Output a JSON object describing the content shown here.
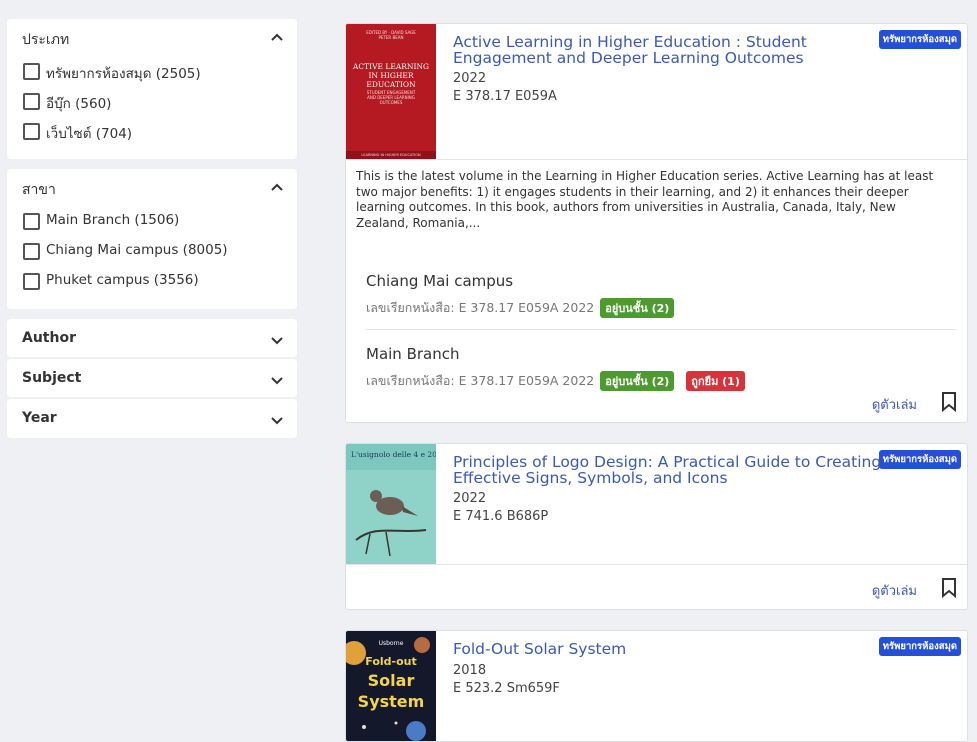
{
  "filters": {
    "type": {
      "title": "ประเภท",
      "options": [
        "ทรัพยากรห้องสมุด (2505)",
        "อีบุ๊ก (560)",
        "เว็บไซต์ (704)"
      ]
    },
    "branch": {
      "title": "สาขา",
      "options": [
        "Main Branch (1506)",
        "Chiang Mai campus (8005)",
        "Phuket campus (3556)"
      ]
    },
    "author": {
      "title": "Author"
    },
    "subject": {
      "title": "Subject"
    },
    "year": {
      "title": "Year"
    }
  },
  "results": [
    {
      "title": "Active Learning in Higher Education : Student Engagement and Deeper Learning Outcomes",
      "year": "2022",
      "call_number": "E 378.17 E059A",
      "badge": "ทรัพยากรห้องสมุด",
      "description": "This is the latest volume in the Learning in Higher Education series. Active Learning has at least two major benefits: 1) it engages students in their learning, and 2) it enhances their deeper learning outcomes. In this book, authors from universities in Australia, Canada, Italy, New Zealand, Romania,...",
      "cover_text": {
        "authors": "EDITED BY\nDAVID SAGE\nPETER BEAN",
        "title": "ACTIVE LEARNING IN HIGHER EDUCATION",
        "subtitle": "STUDENT ENGAGEMENT AND DEEPER LEARNING OUTCOMES",
        "series": "LEARNING IN HIGHER EDUCATION"
      },
      "holdings": [
        {
          "branch": "Chiang Mai campus",
          "call_label": "เลขเรียกหนังสือ: E 378.17 E059A 2022",
          "statuses": [
            {
              "text": "อยู่บนชั้น (2)",
              "color": "#4d9b2e"
            }
          ]
        },
        {
          "branch": "Main Branch",
          "call_label": "เลขเรียกหนังสือ: E 378.17 E059A 2022",
          "statuses": [
            {
              "text": "อยู่บนชั้น (2)",
              "color": "#4d9b2e"
            },
            {
              "text": "ถูกยืม (1)",
              "color": "#d8333a"
            }
          ]
        }
      ],
      "view_label": "ดูตัวเล่ม"
    },
    {
      "title": "Principles of Logo Design: A Practical Guide to Creating Effective Signs, Symbols, and Icons",
      "year": "2022",
      "call_number": "E 741.6 B686P",
      "badge": "ทรัพยากรห้องสมุด",
      "cover_text": {
        "title": "L'usignolo delle 4 e 20"
      },
      "view_label": "ดูตัวเล่ม"
    },
    {
      "title": "Fold-Out Solar System",
      "year": "2018",
      "call_number": "E 523.2 Sm659F",
      "badge": "ทรัพยากรห้องสมุด",
      "cover_text": {
        "brand": "Usborne",
        "title": "Fold-out Solar System"
      }
    }
  ]
}
